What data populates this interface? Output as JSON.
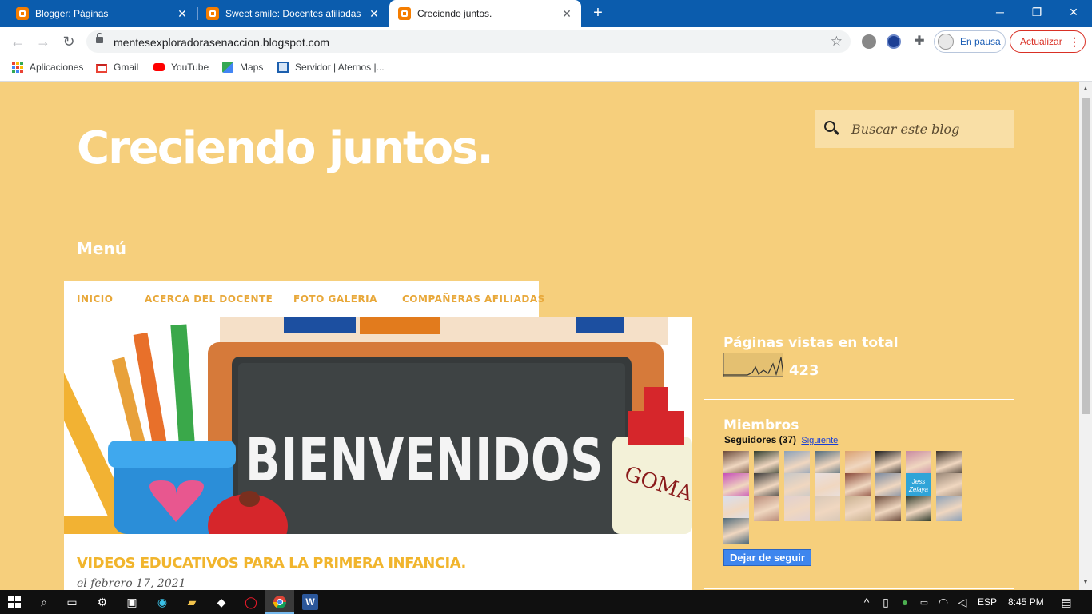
{
  "browser": {
    "tabs": [
      {
        "title": "Blogger: Páginas",
        "active": false
      },
      {
        "title": "Sweet smile: Docentes afiliadas",
        "active": false
      },
      {
        "title": "Creciendo juntos.",
        "active": true
      }
    ],
    "url": "mentesexploradorasenaccion.blogspot.com",
    "profile_label": "En pausa",
    "update_label": "Actualizar",
    "bookmarks": [
      "Aplicaciones",
      "Gmail",
      "YouTube",
      "Maps",
      "Servidor | Aternos |..."
    ]
  },
  "blog": {
    "title": "Creciendo juntos.",
    "search_placeholder": "Buscar este blog",
    "menu_heading": "Menú",
    "menu_items": [
      "INICIO",
      "ACERCA DEL DOCENTE",
      "FOTO GALERIA",
      "COMPAÑERAS AFILIADAS"
    ],
    "banner_text": "BIENVENIDOS",
    "banner_glue": "GOMA",
    "post_title": "VIDEOS EDUCATIVOS PARA LA PRIMERA INFANCIA.",
    "post_date": "el febrero 17, 2021"
  },
  "sidebar": {
    "pageviews_heading": "Páginas vistas en total",
    "pageviews_count": "423",
    "members_heading": "Miembros",
    "followers_label": "Seguidores (37)",
    "followers_link": "Siguiente",
    "avatar_count": 25,
    "avatar_badge_text": "Jess Zelaya",
    "unfollow_label": "Dejar de seguir"
  },
  "taskbar": {
    "lang": "ESP",
    "time": "8:45 PM"
  },
  "colors": {
    "page_bg": "#f6cf7c",
    "accent": "#f1b52d",
    "chrome_blue": "#0b5cad"
  }
}
